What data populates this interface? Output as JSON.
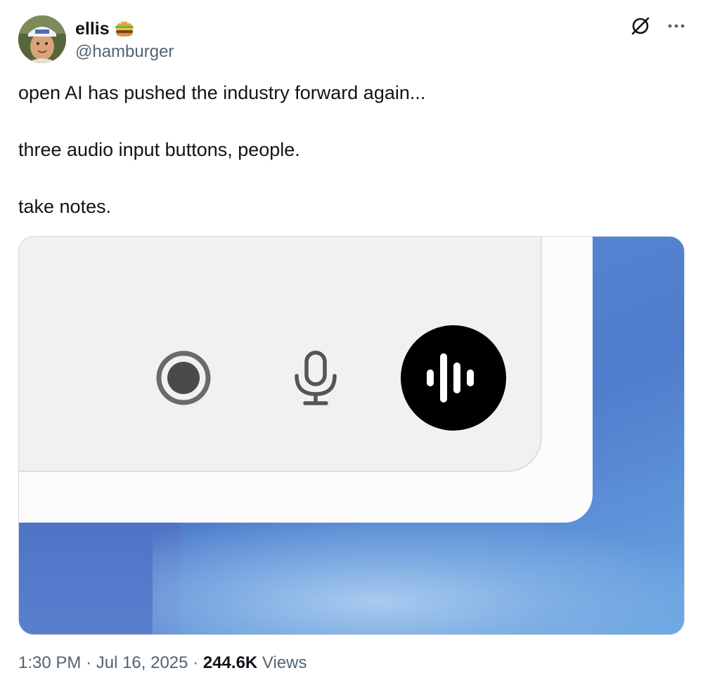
{
  "author": {
    "display_name": "ellis",
    "name_emoji": "🍔",
    "handle": "@hamburger",
    "avatar_icon": "profile-photo"
  },
  "header_actions": {
    "grok_icon": "grok-icon",
    "more_icon": "more-horizontal-icon"
  },
  "tweet": {
    "lines": [
      "open AI has pushed the industry forward again...",
      "three audio input buttons, people.",
      "take notes."
    ]
  },
  "media": {
    "buttons": [
      {
        "icon": "record-icon"
      },
      {
        "icon": "microphone-icon"
      },
      {
        "icon": "voice-waveform-icon"
      }
    ],
    "colors": {
      "background_blue": "#5b8fd6",
      "panel_white": "#fcfcfc",
      "panel_gray": "#f1f1f1",
      "voice_button": "#000000",
      "icon_gray": "#6a6a6a"
    }
  },
  "meta": {
    "time": "1:30 PM",
    "separator": "·",
    "date": "Jul 16, 2025",
    "views_count": "244.6K",
    "views_label": "Views"
  }
}
